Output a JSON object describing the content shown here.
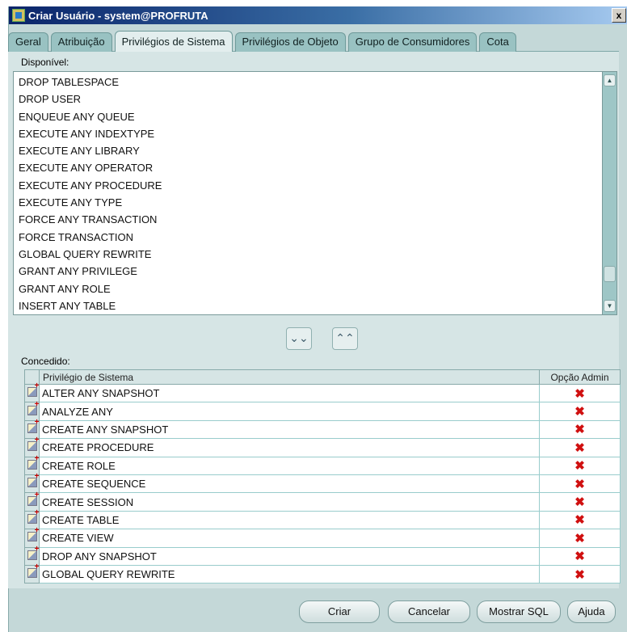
{
  "window": {
    "title": "Criar Usuário - system@PROFRUTA",
    "close_glyph": "x"
  },
  "tabs": [
    {
      "label": "Geral",
      "active": false
    },
    {
      "label": "Atribuição",
      "active": false
    },
    {
      "label": "Privilégios de Sistema",
      "active": true
    },
    {
      "label": "Privilégios de Objeto",
      "active": false
    },
    {
      "label": "Grupo de Consumidores",
      "active": false
    },
    {
      "label": "Cota",
      "active": false
    }
  ],
  "available": {
    "label": "Disponível:",
    "items": [
      "DROP TABLESPACE",
      "DROP USER",
      "ENQUEUE ANY QUEUE",
      "EXECUTE ANY INDEXTYPE",
      "EXECUTE ANY LIBRARY",
      "EXECUTE ANY OPERATOR",
      "EXECUTE ANY PROCEDURE",
      "EXECUTE ANY TYPE",
      "FORCE ANY TRANSACTION",
      "FORCE TRANSACTION",
      "GLOBAL QUERY REWRITE",
      "GRANT ANY PRIVILEGE",
      "GRANT ANY ROLE",
      "INSERT ANY TABLE"
    ]
  },
  "move": {
    "down_glyph": "⌄⌄",
    "up_glyph": "⌃⌃"
  },
  "granted": {
    "label": "Concedido:",
    "columns": {
      "privilege": "Privilégio de Sistema",
      "admin": "Opção Admin"
    },
    "admin_glyph": "✖",
    "rows": [
      "ALTER ANY SNAPSHOT",
      "ANALYZE ANY",
      "CREATE ANY SNAPSHOT",
      "CREATE PROCEDURE",
      "CREATE ROLE",
      "CREATE SEQUENCE",
      "CREATE SESSION",
      "CREATE TABLE",
      "CREATE VIEW",
      "DROP ANY SNAPSHOT",
      "GLOBAL QUERY REWRITE"
    ]
  },
  "buttons": {
    "create": "Criar",
    "cancel": "Cancelar",
    "show_sql": "Mostrar SQL",
    "help": "Ajuda"
  },
  "icons": [
    "app-icon",
    "close-icon",
    "scroll-up-icon",
    "scroll-down-icon",
    "move-down-icon",
    "move-up-icon",
    "row-edit-icon",
    "admin-off-icon"
  ]
}
